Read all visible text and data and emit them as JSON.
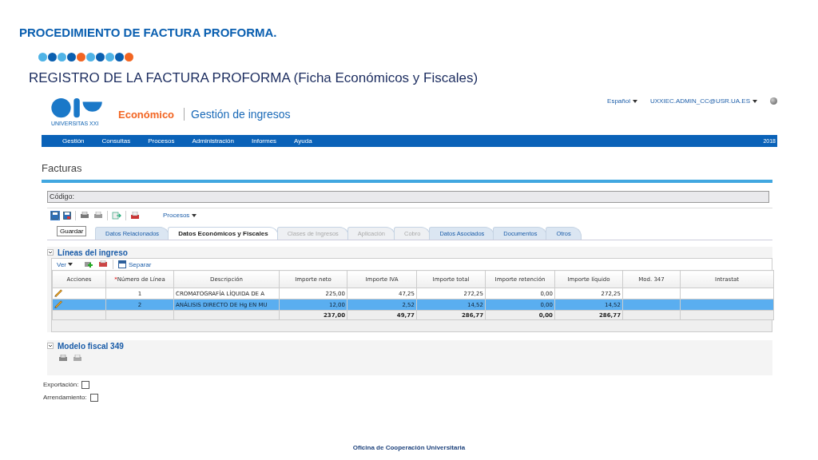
{
  "slide": {
    "title": "PROCEDIMIENTO DE FACTURA PROFORMA.",
    "subtitle": "REGISTRO DE LA FACTURA PROFORMA (Ficha Económicos y Fiscales)",
    "footer": "Oficina de Cooperación Universitaria",
    "dots": [
      {
        "color": "#4fb3e6"
      },
      {
        "color": "#0a5fb0"
      },
      {
        "color": "#4fb3e6"
      },
      {
        "color": "#0a5fb0"
      },
      {
        "color": "#f26522"
      },
      {
        "color": "#4fb3e6"
      },
      {
        "color": "#0a5fb0"
      },
      {
        "color": "#4fb3e6"
      },
      {
        "color": "#0a5fb0"
      },
      {
        "color": "#f26522"
      }
    ]
  },
  "app": {
    "logo_text": "UNIVERSITAS XXI",
    "module": "Económico",
    "section": "Gestión de ingresos",
    "language": "Español",
    "user": "UXXIEC.ADMIN_CC@USR.UA.ES",
    "menu": [
      "Gestión",
      "Consultas",
      "Procesos",
      "Administración",
      "Informes",
      "Ayuda"
    ],
    "year": "2018",
    "page_title": "Facturas",
    "code_label": "Código:",
    "processes": "Procesos",
    "tooltip": "Guardar",
    "tabs": [
      {
        "label": "Datos Relacionados",
        "selected": false,
        "disabled": false
      },
      {
        "label": "Datos Económicos y Fiscales",
        "selected": true,
        "disabled": false
      },
      {
        "label": "Clases de Ingresos",
        "selected": false,
        "disabled": true
      },
      {
        "label": "Aplicación",
        "selected": false,
        "disabled": true
      },
      {
        "label": "Cobro",
        "selected": false,
        "disabled": true
      },
      {
        "label": "Datos Asociados",
        "selected": false,
        "disabled": false
      },
      {
        "label": "Documentos",
        "selected": false,
        "disabled": false
      },
      {
        "label": "Otros",
        "selected": false,
        "disabled": false
      }
    ],
    "lines": {
      "title": "Líneas del ingreso",
      "view": "Ver",
      "split": "Separar",
      "columns": [
        "Acciones",
        "Número de Línea",
        "Descripción",
        "Importe neto",
        "Importe IVA",
        "Importe total",
        "Importe retención",
        "Importe líquido",
        "Mod. 347",
        "Intrastat"
      ],
      "required_mark": "*",
      "rows": [
        {
          "selected": false,
          "cells": [
            "",
            "1",
            "CROMATOGRAFÍA LÍQUIDA DE A",
            "225,00",
            "47,25",
            "272,25",
            "0,00",
            "272,25",
            "",
            ""
          ]
        },
        {
          "selected": true,
          "cells": [
            "",
            "2",
            "ANÁLISIS DIRECTO DE Hg EN MU",
            "12,00",
            "2,52",
            "14,52",
            "0,00",
            "14,52",
            "",
            ""
          ]
        }
      ],
      "totals": [
        "237,00",
        "49,77",
        "286,77",
        "0,00",
        "286,77"
      ]
    },
    "fiscal": {
      "title": "Modelo fiscal 349"
    },
    "checks": [
      {
        "label": "Exportación:",
        "checked": false
      },
      {
        "label": "Arrendamiento:",
        "checked": false
      }
    ]
  }
}
